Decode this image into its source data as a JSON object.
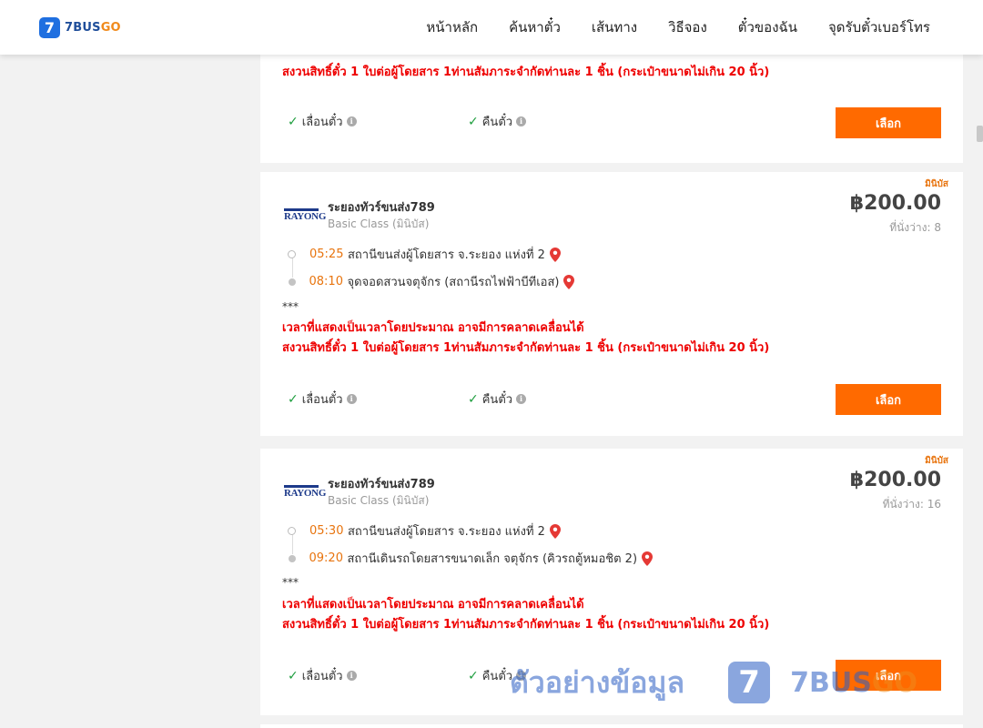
{
  "brand": {
    "badge": "7",
    "name_a": "7BUS",
    "name_b": "GO"
  },
  "nav": [
    {
      "label": "หน้าหลัก"
    },
    {
      "label": "ค้นหาตั๋ว"
    },
    {
      "label": "เส้นทาง"
    },
    {
      "label": "วิธีจอง"
    },
    {
      "label": "ตั๋วของฉัน"
    },
    {
      "label": "จุดรับตั๋วเบอร์โทร"
    }
  ],
  "partial_card": {
    "note2": "สงวนสิทธิ์ตั๋ว 1 ใบต่อผู้โดยสาร 1ท่านสัมภาระจำกัดท่านละ 1 ชิ้น (กระเป๋าขนาดไม่เกิน 20 นิ้ว)",
    "opt_change": "เลื่อนตั๋ว",
    "opt_refund": "คืนตั๋ว",
    "select_label": "เลือก"
  },
  "trips": [
    {
      "tag": "มินิบัส",
      "logo_text": "RAYONG",
      "operator": "ระยองทัวร์ขนส่ง789",
      "class": "Basic Class (มินิบัส)",
      "price": "฿200.00",
      "seats": "ที่นั่งว่าง: 8",
      "depart_time": "05:25",
      "depart_place": "สถานีขนส่งผู้โดยสาร จ.ระยอง แห่งที่ 2",
      "arrive_time": "08:10",
      "arrive_place": "จุดจอดสวนจตุจักร (สถานีรถไฟฟ้าบีทีเอส)",
      "stars": "***",
      "note1": "เวลาที่แสดงเป็นเวลาโดยประมาณ อาจมีการคลาดเคลื่อนได้",
      "note2": "สงวนสิทธิ์ตั๋ว 1 ใบต่อผู้โดยสาร 1ท่านสัมภาระจำกัดท่านละ 1 ชิ้น (กระเป๋าขนาดไม่เกิน 20 นิ้ว)",
      "opt_change": "เลื่อนตั๋ว",
      "opt_refund": "คืนตั๋ว",
      "select_label": "เลือก"
    },
    {
      "tag": "มินิบัส",
      "logo_text": "RAYONG",
      "operator": "ระยองทัวร์ขนส่ง789",
      "class": "Basic Class (มินิบัส)",
      "price": "฿200.00",
      "seats": "ที่นั่งว่าง: 16",
      "depart_time": "05:30",
      "depart_place": "สถานีขนส่งผู้โดยสาร จ.ระยอง แห่งที่ 2",
      "arrive_time": "09:20",
      "arrive_place": "สถานีเดินรถโดยสารขนาดเล็ก จตุจักร (คิวรถตู้หมอชิต 2)",
      "stars": "***",
      "note1": "เวลาที่แสดงเป็นเวลาโดยประมาณ อาจมีการคลาดเคลื่อนได้",
      "note2": "สงวนสิทธิ์ตั๋ว 1 ใบต่อผู้โดยสาร 1ท่านสัมภาระจำกัดท่านละ 1 ชิ้น (กระเป๋าขนาดไม่เกิน 20 นิ้ว)",
      "opt_change": "เลื่อนตั๋ว",
      "opt_refund": "คืนตั๋ว",
      "select_label": "เลือก"
    }
  ],
  "watermark": {
    "text": "ตัวอย่างข้อมูล",
    "badge": "7",
    "brand_a": "7BUS",
    "brand_b": "GO"
  },
  "colors": {
    "accent": "#ff6a00",
    "time": "#e8740e",
    "warning": "#e00000",
    "check": "#1e9e3e",
    "brand_blue": "#1f6fe0"
  }
}
